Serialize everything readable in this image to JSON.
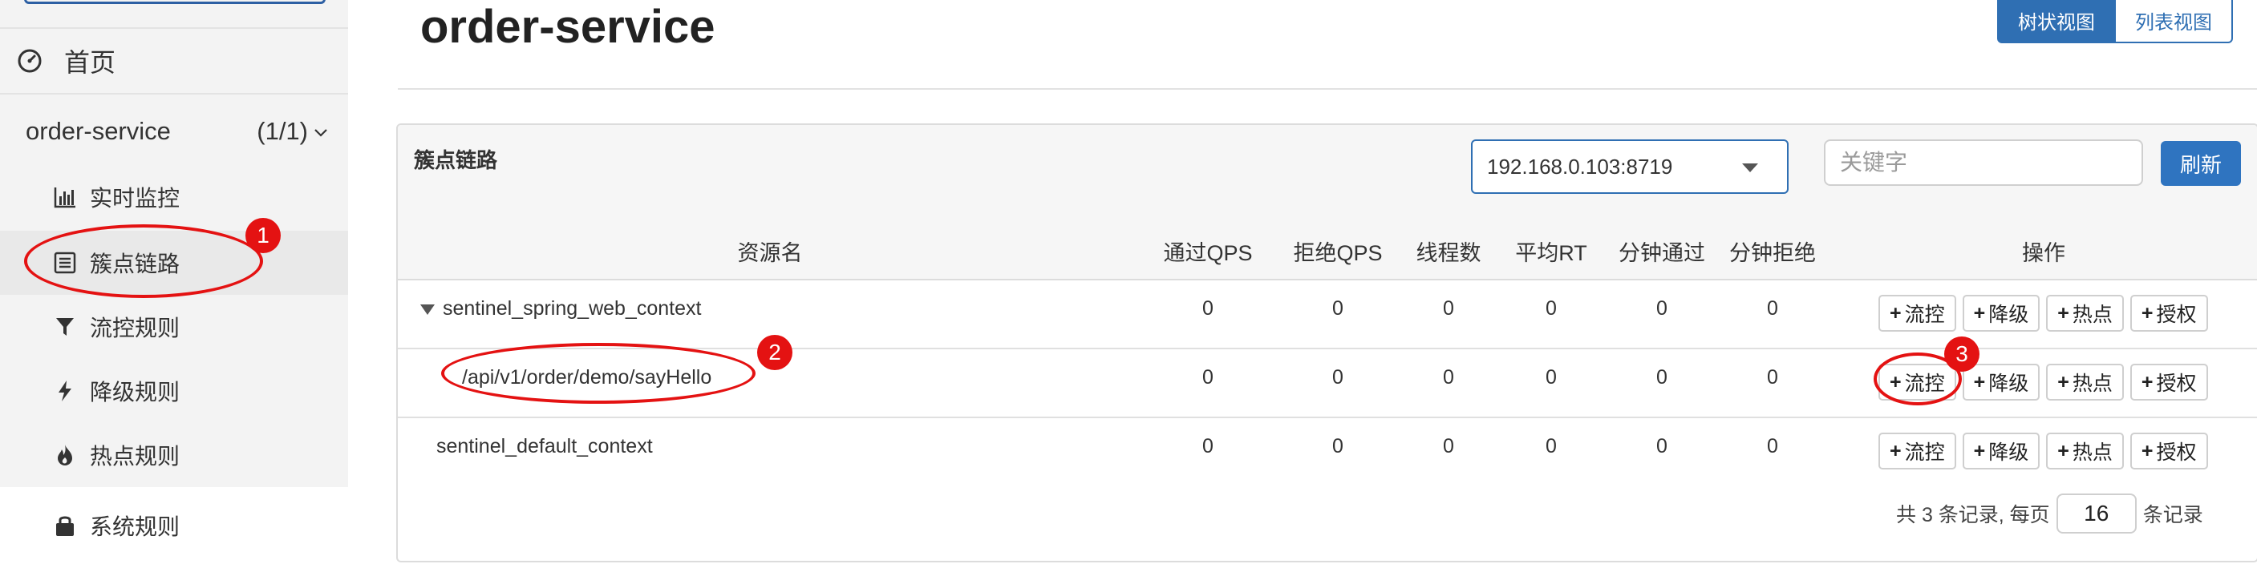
{
  "sidebar": {
    "home_label": "首页",
    "app_name": "order-service",
    "app_count": "(1/1)",
    "items": [
      {
        "label": "实时监控",
        "icon": "bar-chart-icon"
      },
      {
        "label": "簇点链路",
        "icon": "list-icon"
      },
      {
        "label": "流控规则",
        "icon": "filter-icon"
      },
      {
        "label": "降级规则",
        "icon": "flash-icon"
      },
      {
        "label": "热点规则",
        "icon": "fire-icon"
      },
      {
        "label": "系统规则",
        "icon": "lock-icon"
      }
    ]
  },
  "header": {
    "title": "order-service",
    "view_tree": "树状视图",
    "view_list": "列表视图"
  },
  "panel": {
    "title": "簇点链路",
    "machine": "192.168.0.103:8719",
    "keyword_placeholder": "关键字",
    "refresh_label": "刷新"
  },
  "table": {
    "columns": [
      "资源名",
      "通过QPS",
      "拒绝QPS",
      "线程数",
      "平均RT",
      "分钟通过",
      "分钟拒绝",
      "操作"
    ],
    "rows": [
      {
        "name": "sentinel_spring_web_context",
        "values": [
          "0",
          "0",
          "0",
          "0",
          "0",
          "0"
        ]
      },
      {
        "name": "/api/v1/order/demo/sayHello",
        "values": [
          "0",
          "0",
          "0",
          "0",
          "0",
          "0"
        ]
      },
      {
        "name": "sentinel_default_context",
        "values": [
          "0",
          "0",
          "0",
          "0",
          "0",
          "0"
        ]
      }
    ],
    "actions": [
      "流控",
      "降级",
      "热点",
      "授权"
    ]
  },
  "pager": {
    "prefix": "共 3 条记录, 每页",
    "page_size": "16",
    "suffix": "条记录"
  },
  "annotations": [
    "1",
    "2",
    "3"
  ],
  "colors": {
    "accent": "#2f6fb3",
    "annotation": "#e41212",
    "sidebar_bg": "#f3f3f3"
  }
}
